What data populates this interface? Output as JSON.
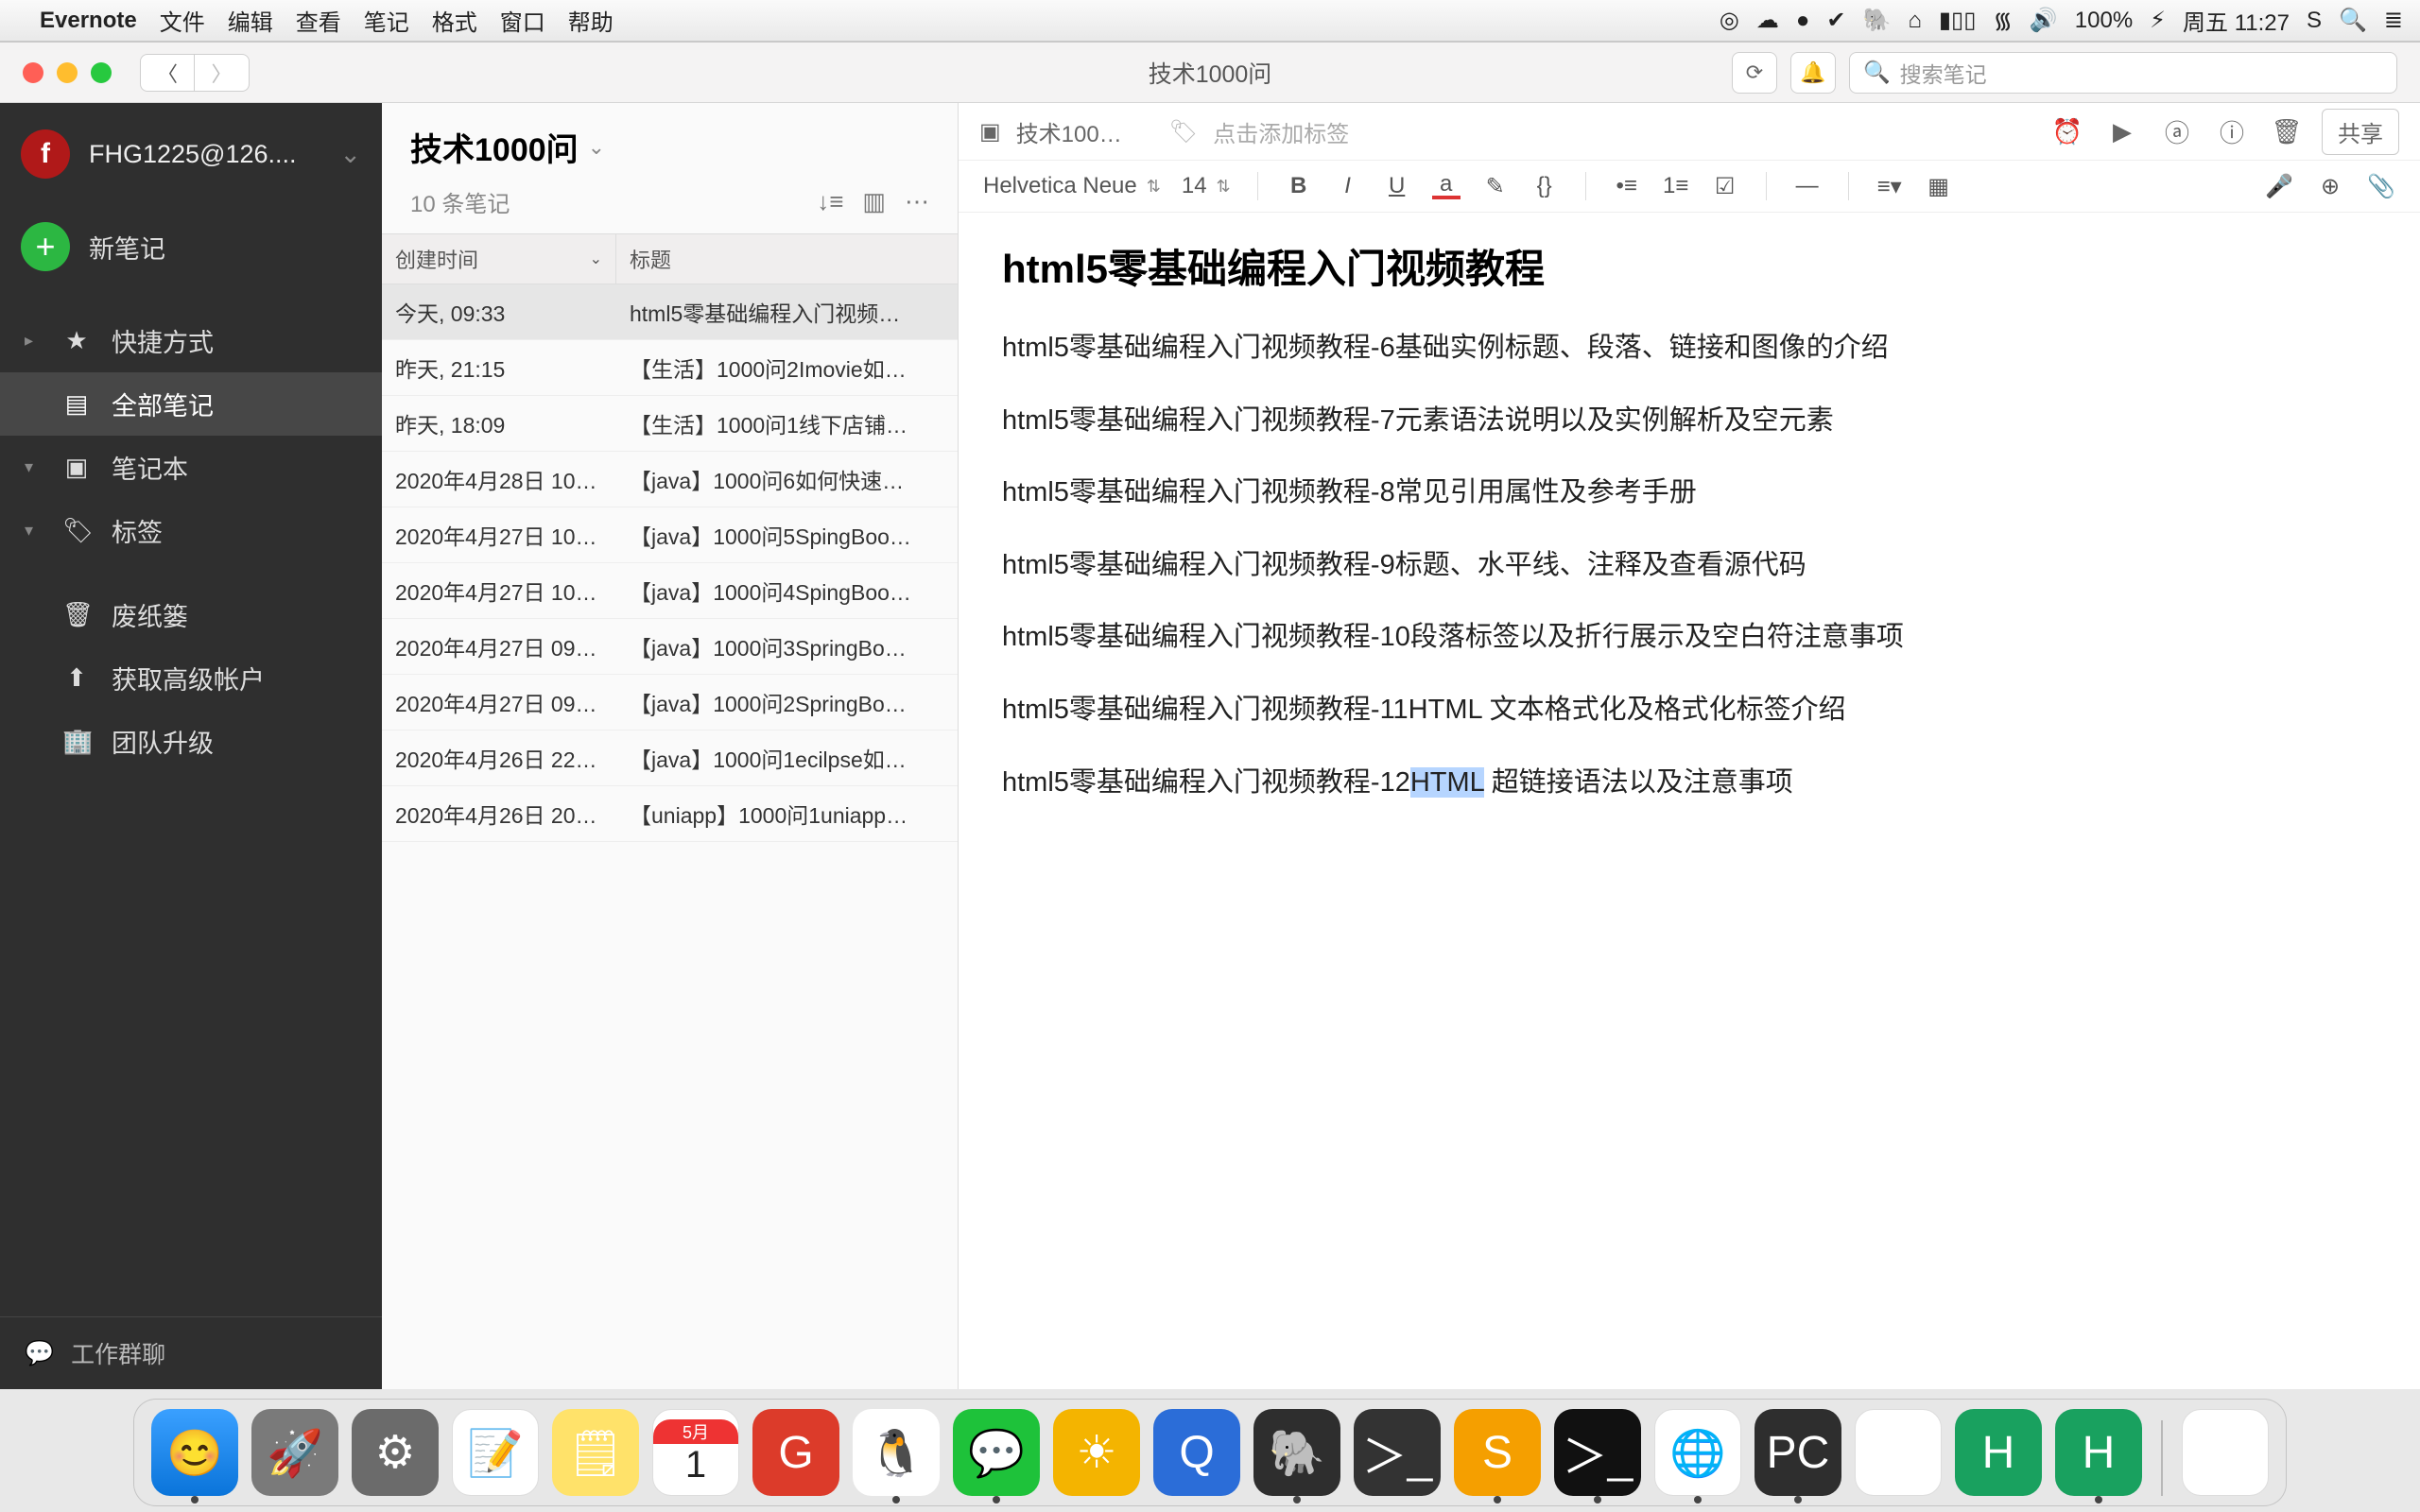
{
  "menubar": {
    "app": "Evernote",
    "items": [
      "文件",
      "编辑",
      "查看",
      "笔记",
      "格式",
      "窗口",
      "帮助"
    ],
    "status": [
      "◎",
      "☁︎",
      "●",
      "✔︎",
      "🐘",
      "⌂",
      "▮▯▯",
      "᯾",
      "🔊",
      "100%",
      "⚡︎",
      "周五 11:27",
      "S",
      "🔍",
      "≣"
    ]
  },
  "titlebar": {
    "title": "技术1000问",
    "search_placeholder": "搜索笔记"
  },
  "sidebar": {
    "account": "FHG1225@126....",
    "new_note": "新笔记",
    "items": [
      {
        "icon": "★",
        "label": "快捷方式",
        "caret": "▸"
      },
      {
        "icon": "▤",
        "label": "全部笔记",
        "caret": "",
        "active": true
      },
      {
        "icon": "▣",
        "label": "笔记本",
        "caret": "▾"
      },
      {
        "icon": "🏷",
        "label": "标签",
        "caret": "▾"
      }
    ],
    "extra": [
      {
        "icon": "🗑",
        "label": "废纸篓"
      },
      {
        "icon": "⬆",
        "label": "获取高级帐户"
      },
      {
        "icon": "🏢",
        "label": "团队升级"
      }
    ],
    "footer": {
      "icon": "💬",
      "label": "工作群聊"
    }
  },
  "notelist": {
    "title": "技术1000问",
    "count": "10 条笔记",
    "col_date": "创建时间",
    "col_title": "标题",
    "rows": [
      {
        "date": "今天, 09:33",
        "title": "html5零基础编程入门视频…",
        "sel": true
      },
      {
        "date": "昨天, 21:15",
        "title": "【生活】1000问2Imovie如…"
      },
      {
        "date": "昨天, 18:09",
        "title": "【生活】1000问1线下店铺…"
      },
      {
        "date": "2020年4月28日 10…",
        "title": "【java】1000问6如何快速…"
      },
      {
        "date": "2020年4月27日 10…",
        "title": "【java】1000问5SpingBoo…"
      },
      {
        "date": "2020年4月27日 10…",
        "title": "【java】1000问4SpingBoo…"
      },
      {
        "date": "2020年4月27日 09…",
        "title": "【java】1000问3SpringBo…"
      },
      {
        "date": "2020年4月27日 09…",
        "title": "【java】1000问2SpringBo…"
      },
      {
        "date": "2020年4月26日 22…",
        "title": "【java】1000问1ecilpse如…"
      },
      {
        "date": "2020年4月26日 20…",
        "title": "【uniapp】1000问1uniapp…"
      }
    ]
  },
  "editor": {
    "breadcrumb": "技术100…",
    "tag_placeholder": "点击添加标签",
    "share": "共享",
    "font": "Helvetica Neue",
    "size": "14",
    "heading": "html5零基础编程入门视频教程",
    "lines": [
      "html5零基础编程入门视频教程-6基础实例标题、段落、链接和图像的介绍",
      "html5零基础编程入门视频教程-7元素语法说明以及实例解析及空元素",
      "html5零基础编程入门视频教程-8常见引用属性及参考手册",
      "html5零基础编程入门视频教程-9标题、水平线、注释及查看源代码",
      "html5零基础编程入门视频教程-10段落标签以及折行展示及空白符注意事项",
      "html5零基础编程入门视频教程-11HTML 文本格式化及格式化标签介绍"
    ],
    "line12_a": "html5零基础编程入门视频教程-12",
    "line12_sel": "HTML",
    "line12_b": " 超链接语法以及注意事项"
  },
  "dock": {
    "apps": [
      "Finder",
      "Launchpad",
      "系统偏好",
      "备忘录",
      "便笺",
      "日历",
      "红色应用",
      "QQ",
      "微信",
      "黄色应用",
      "QuickTime",
      "Evernote",
      "终端",
      "Sublime",
      "iTerm",
      "Chrome",
      "PyCharm",
      "Eclipse",
      "HBuilder",
      "HBuilder"
    ],
    "trash": "废纸篓"
  }
}
